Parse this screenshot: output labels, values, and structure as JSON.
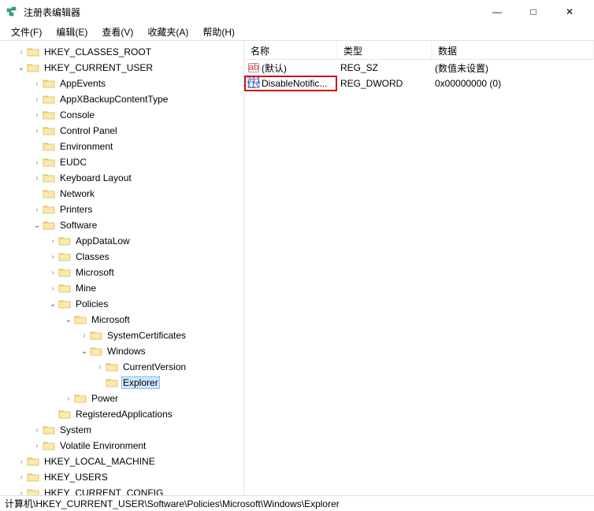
{
  "window": {
    "title": "注册表编辑器",
    "controls": {
      "min": "—",
      "max": "□",
      "close": "✕"
    }
  },
  "menu": {
    "file": "文件(F)",
    "edit": "编辑(E)",
    "view": "查看(V)",
    "favorites": "收藏夹(A)",
    "help": "帮助(H)"
  },
  "columns": {
    "name": "名称",
    "type": "类型",
    "data": "数据"
  },
  "values": [
    {
      "icon": "string",
      "name": "(默认)",
      "type": "REG_SZ",
      "data": "(数值未设置)",
      "highlight": false
    },
    {
      "icon": "binary",
      "name": "DisableNotific...",
      "type": "REG_DWORD",
      "data": "0x00000000 (0)",
      "highlight": true
    }
  ],
  "tree": {
    "hkcr": "HKEY_CLASSES_ROOT",
    "hkcu": "HKEY_CURRENT_USER",
    "appevents": "AppEvents",
    "appxbackup": "AppXBackupContentType",
    "console": "Console",
    "controlpanel": "Control Panel",
    "environment": "Environment",
    "eudc": "EUDC",
    "keyboard": "Keyboard Layout",
    "network": "Network",
    "printers": "Printers",
    "software": "Software",
    "appdatalow": "AppDataLow",
    "classes": "Classes",
    "microsoft": "Microsoft",
    "mine": "Mine",
    "policies": "Policies",
    "policies_ms": "Microsoft",
    "syscerts": "SystemCertificates",
    "windows": "Windows",
    "currentversion": "CurrentVersion",
    "explorer": "Explorer",
    "power": "Power",
    "regapps": "RegisteredApplications",
    "system": "System",
    "volenv": "Volatile Environment",
    "hklm": "HKEY_LOCAL_MACHINE",
    "hku": "HKEY_USERS",
    "hkcc": "HKEY_CURRENT_CONFIG"
  },
  "statusbar": {
    "path": "计算机\\HKEY_CURRENT_USER\\Software\\Policies\\Microsoft\\Windows\\Explorer"
  }
}
